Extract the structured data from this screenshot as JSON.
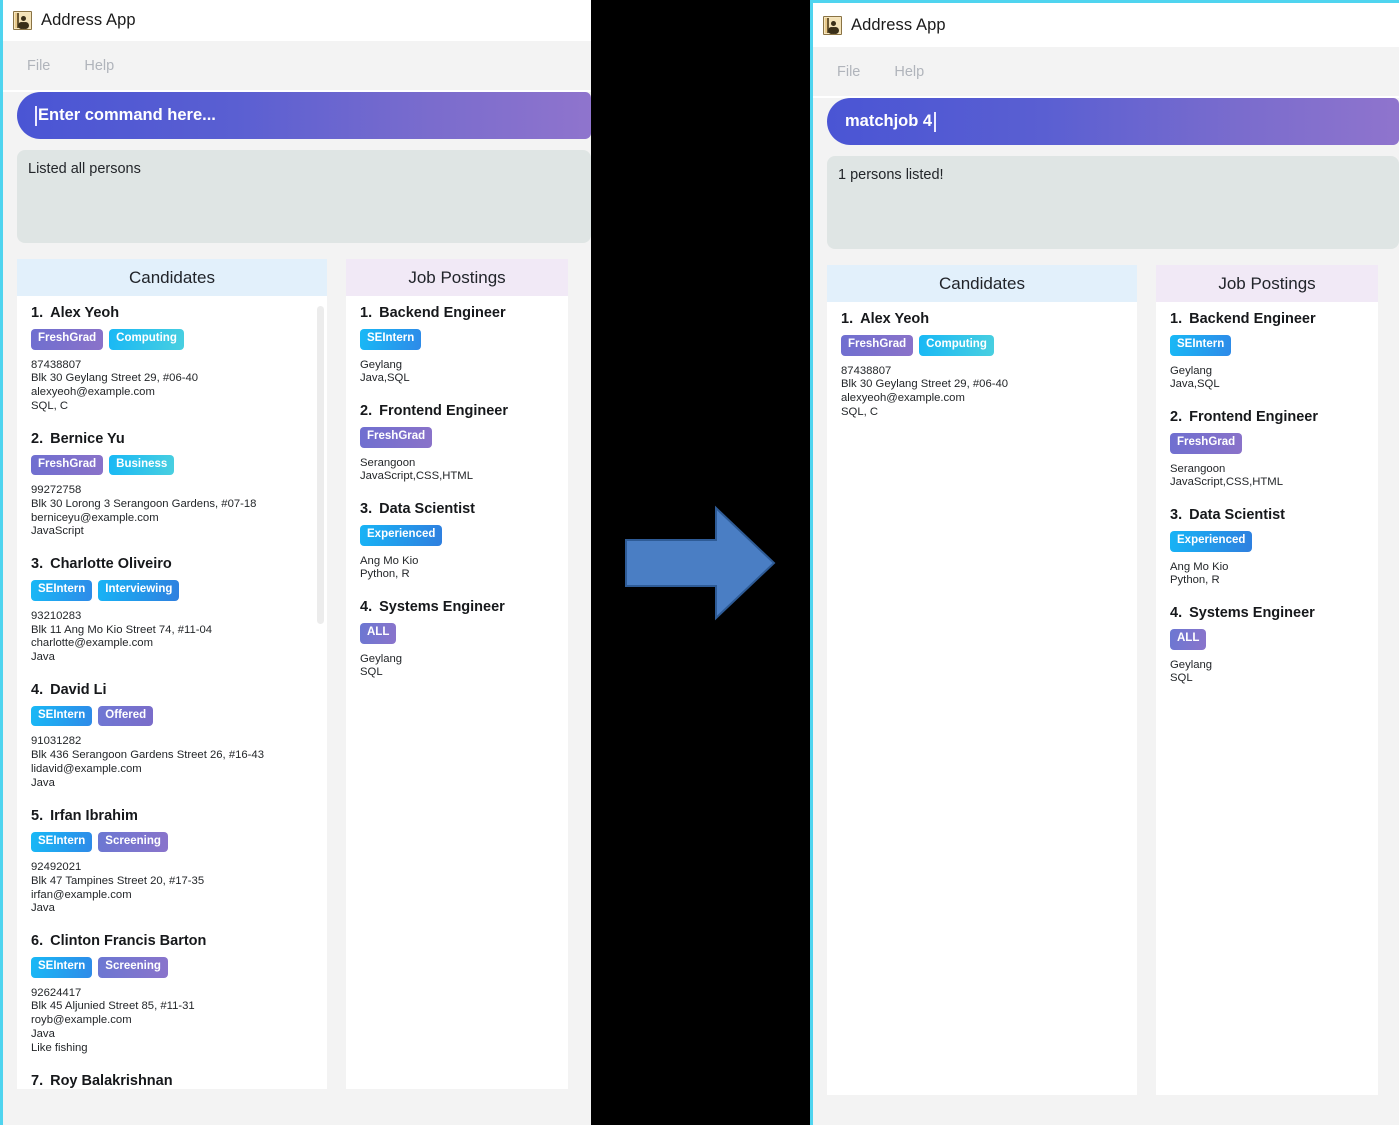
{
  "window_left": {
    "title": "Address App",
    "icon": "address-book-icon",
    "menu": [
      "File",
      "Help"
    ],
    "command": {
      "value": "",
      "placeholder": "Enter command here..."
    },
    "result": "Listed all persons",
    "panels": {
      "candidates": {
        "header": "Candidates",
        "items": [
          {
            "num": "1.",
            "name": "Alex Yeoh",
            "tags": [
              {
                "label": "FreshGrad",
                "style": "purple"
              },
              {
                "label": "Computing",
                "style": "cyan"
              }
            ],
            "lines": [
              "87438807",
              "Blk 30 Geylang Street 29, #06-40",
              "alexyeoh@example.com",
              "SQL, C"
            ]
          },
          {
            "num": "2.",
            "name": "Bernice Yu",
            "tags": [
              {
                "label": "FreshGrad",
                "style": "purple"
              },
              {
                "label": "Business",
                "style": "cyan"
              }
            ],
            "lines": [
              "99272758",
              "Blk 30 Lorong 3 Serangoon Gardens, #07-18",
              "berniceyu@example.com",
              "JavaScript"
            ]
          },
          {
            "num": "3.",
            "name": "Charlotte Oliveiro",
            "tags": [
              {
                "label": "SEIntern",
                "style": "skyblue"
              },
              {
                "label": "Interviewing",
                "style": "cyanblue"
              }
            ],
            "lines": [
              "93210283",
              "Blk 11 Ang Mo Kio Street 74, #11-04",
              "charlotte@example.com",
              "Java"
            ]
          },
          {
            "num": "4.",
            "name": "David Li",
            "tags": [
              {
                "label": "SEIntern",
                "style": "skyblue"
              },
              {
                "label": "Offered",
                "style": "bluepurp"
              }
            ],
            "lines": [
              "91031282",
              "Blk 436 Serangoon Gardens Street 26, #16-43",
              "lidavid@example.com",
              "Java"
            ]
          },
          {
            "num": "5.",
            "name": "Irfan Ibrahim",
            "tags": [
              {
                "label": "SEIntern",
                "style": "skyblue"
              },
              {
                "label": "Screening",
                "style": "indigo"
              }
            ],
            "lines": [
              "92492021",
              "Blk 47 Tampines Street 20, #17-35",
              "irfan@example.com",
              "Java"
            ]
          },
          {
            "num": "6.",
            "name": "Clinton Francis Barton",
            "tags": [
              {
                "label": "SEIntern",
                "style": "skyblue"
              },
              {
                "label": "Screening",
                "style": "indigo"
              }
            ],
            "lines": [
              "92624417",
              "Blk 45 Aljunied Street 85, #11-31",
              "royb@example.com",
              "Java",
              "Like fishing"
            ]
          },
          {
            "num": "7.",
            "name": "Roy Balakrishnan",
            "tags": [
              {
                "label": "",
                "style": "skyblue"
              },
              {
                "label": "",
                "style": "indigo"
              }
            ],
            "lines": []
          }
        ]
      },
      "jobs": {
        "header": "Job Postings",
        "items": [
          {
            "num": "1.",
            "name": "Backend Engineer",
            "tags": [
              {
                "label": "SEIntern",
                "style": "skyblue"
              }
            ],
            "lines": [
              "Geylang",
              "Java,SQL"
            ]
          },
          {
            "num": "2.",
            "name": "Frontend Engineer",
            "tags": [
              {
                "label": "FreshGrad",
                "style": "purple"
              }
            ],
            "lines": [
              "Serangoon",
              "JavaScript,CSS,HTML"
            ]
          },
          {
            "num": "3.",
            "name": "Data Scientist",
            "tags": [
              {
                "label": "Experienced",
                "style": "cyanblue"
              }
            ],
            "lines": [
              "Ang Mo Kio",
              "Python, R"
            ]
          },
          {
            "num": "4.",
            "name": "Systems Engineer",
            "tags": [
              {
                "label": "ALL",
                "style": "indigo"
              }
            ],
            "lines": [
              "Geylang",
              "SQL"
            ]
          }
        ]
      }
    }
  },
  "window_right": {
    "title": "Address App",
    "icon": "address-book-icon",
    "menu": [
      "File",
      "Help"
    ],
    "command": {
      "value": "matchjob 4",
      "placeholder": "Enter command here..."
    },
    "result": "1 persons listed!",
    "panels": {
      "candidates": {
        "header": "Candidates",
        "items": [
          {
            "num": "1.",
            "name": "Alex Yeoh",
            "tags": [
              {
                "label": "FreshGrad",
                "style": "purple"
              },
              {
                "label": "Computing",
                "style": "cyan"
              }
            ],
            "lines": [
              "87438807",
              "Blk 30 Geylang Street 29, #06-40",
              "alexyeoh@example.com",
              "SQL, C"
            ]
          }
        ]
      },
      "jobs": {
        "header": "Job Postings",
        "items": [
          {
            "num": "1.",
            "name": "Backend Engineer",
            "tags": [
              {
                "label": "SEIntern",
                "style": "skyblue"
              }
            ],
            "lines": [
              "Geylang",
              "Java,SQL"
            ]
          },
          {
            "num": "2.",
            "name": "Frontend Engineer",
            "tags": [
              {
                "label": "FreshGrad",
                "style": "purple"
              }
            ],
            "lines": [
              "Serangoon",
              "JavaScript,CSS,HTML"
            ]
          },
          {
            "num": "3.",
            "name": "Data Scientist",
            "tags": [
              {
                "label": "Experienced",
                "style": "cyanblue"
              }
            ],
            "lines": [
              "Ang Mo Kio",
              "Python, R"
            ]
          },
          {
            "num": "4.",
            "name": "Systems Engineer",
            "tags": [
              {
                "label": "ALL",
                "style": "indigo"
              }
            ],
            "lines": [
              "Geylang",
              "SQL"
            ]
          }
        ]
      }
    }
  },
  "transition": {
    "icon": "right-arrow-icon",
    "arrow_fill": "#4a7ec4",
    "arrow_stroke": "#2e5b96",
    "background": "#000000"
  },
  "theme": {
    "accent_border": "#4fd4ef",
    "command_gradient_from": "#4a55d4",
    "command_gradient_to": "#8f74cd",
    "result_bg": "#dfe5e4",
    "candidates_header_bg": "#e2f0fb",
    "jobs_header_bg": "#f1e9f6"
  }
}
